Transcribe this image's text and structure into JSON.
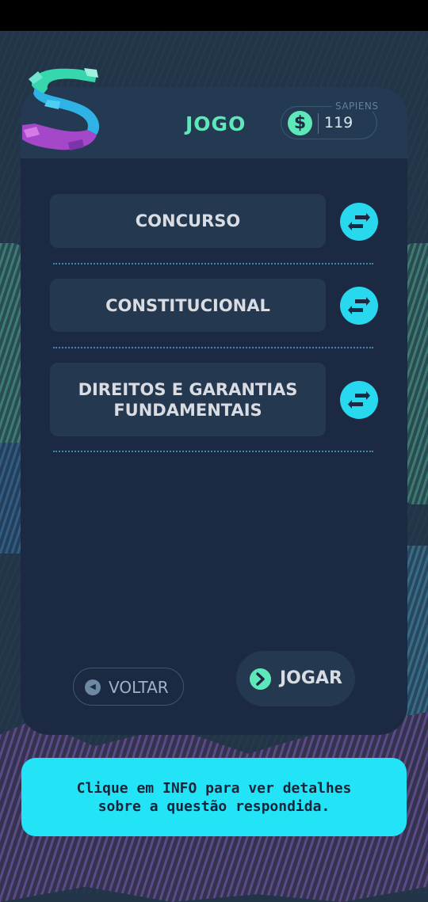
{
  "header": {
    "title": "JOGO",
    "currency_label": "SAPIENS",
    "currency_icon": "$",
    "currency_value": "119"
  },
  "options": [
    {
      "label": "CONCURSO"
    },
    {
      "label": "CONSTITUCIONAL"
    },
    {
      "label": "DIREITOS E GARANTIAS FUNDAMENTAIS"
    }
  ],
  "footer": {
    "back_label": "VOLTAR",
    "play_label": "JOGAR"
  },
  "info": {
    "message": "Clique em INFO para ver detalhes sobre a questão respondida."
  },
  "colors": {
    "accent_green": "#5ee8ba",
    "accent_cyan": "#27d8ef",
    "card_bg": "#1b2a42"
  },
  "icons": {
    "logo": "sapiens-s-logo",
    "swap": "swap-arrows-icon",
    "back": "chevron-left-circle-icon",
    "play": "chevron-right-circle-icon"
  }
}
